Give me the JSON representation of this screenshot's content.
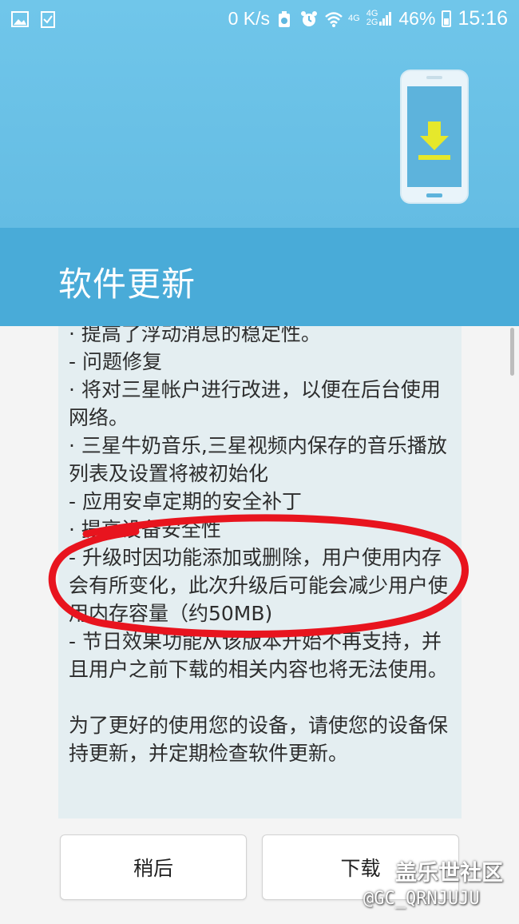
{
  "status_bar": {
    "network_speed": "0 K/s",
    "signal_4g_label": "4G",
    "signal_4g_2g_label": "4G\n2G",
    "battery_percent": "46%",
    "time": "15:16"
  },
  "header": {
    "title": "软件更新"
  },
  "release_notes": {
    "text": "· 提高了浮动消息的稳定性。\n- 问题修复\n· 将对三星帐户进行改进，以便在后台使用网络。\n· 三星牛奶音乐,三星视频内保存的音乐播放列表及设置将被初始化\n- 应用安卓定期的安全补丁\n· 提高设备安全性\n- 升级时因功能添加或删除，用户使用内存会有所变化，此次升级后可能会减少用户使用内存容量（约50MB)\n- 节日效果功能从该版本开始不再支持，并且用户之前下载的相关内容也将无法使用。\n\n为了更好的使用您的设备，请使您的设备保持更新，并定期检查软件更新。"
  },
  "buttons": {
    "later_label": "稍后",
    "download_label": "下载"
  },
  "watermark": {
    "line1": "盖乐世社区",
    "line2": "@GC_QRNJUJU"
  },
  "colors": {
    "hero_top": "#70c6ea",
    "title_bar": "#49abd8",
    "notes_background": "#e4eef1",
    "annotation_red": "#e8141e"
  },
  "icons": [
    "gallery-icon",
    "task-check-icon",
    "data-saver-icon",
    "alarm-icon",
    "wifi-icon",
    "signal-icon",
    "battery-icon",
    "phone-download-icon"
  ]
}
